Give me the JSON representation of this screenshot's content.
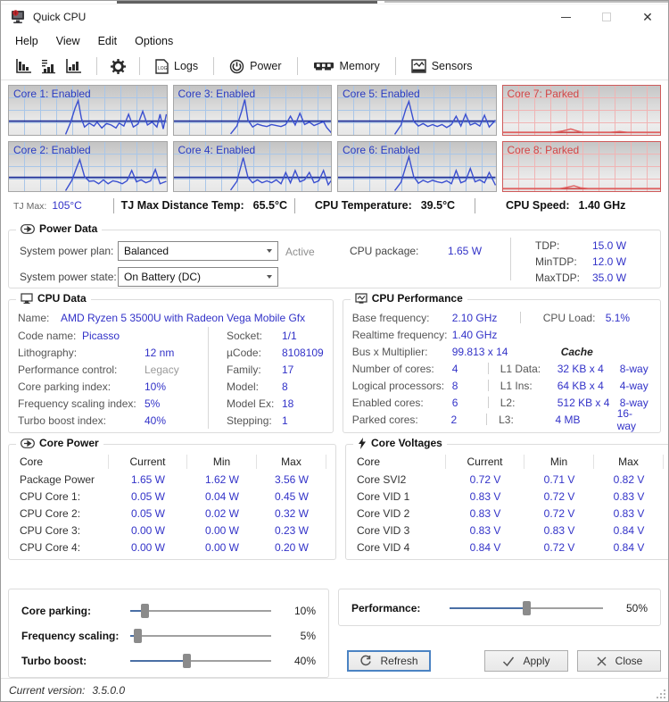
{
  "window": {
    "title": "Quick CPU"
  },
  "menu": {
    "items": [
      "Help",
      "View",
      "Edit",
      "Options"
    ]
  },
  "toolbar": {
    "logs": "Logs",
    "power": "Power",
    "memory": "Memory",
    "sensors": "Sensors"
  },
  "colors": {
    "value_blue": "#3232c8",
    "enabled_line": "#3a4fd0",
    "enabled_baseline": "#1d2f9a",
    "parked_line": "#e06060",
    "parked_baseline": "#cc4a4a"
  },
  "cores": [
    {
      "label": "Core 1: Enabled",
      "state": "enabled",
      "baseline": 72,
      "points": [
        [
          36,
          99
        ],
        [
          39,
          76
        ],
        [
          42,
          46
        ],
        [
          44,
          30
        ],
        [
          46,
          66
        ],
        [
          48,
          84
        ],
        [
          51,
          76
        ],
        [
          54,
          82
        ],
        [
          56,
          74
        ],
        [
          59,
          86
        ],
        [
          62,
          77
        ],
        [
          65,
          80
        ],
        [
          68,
          86
        ],
        [
          70,
          76
        ],
        [
          73,
          82
        ],
        [
          76,
          58
        ],
        [
          79,
          84
        ],
        [
          82,
          78
        ],
        [
          85,
          52
        ],
        [
          88,
          80
        ],
        [
          91,
          74
        ],
        [
          94,
          84
        ],
        [
          96,
          58
        ],
        [
          98,
          88
        ],
        [
          100,
          58
        ]
      ]
    },
    {
      "label": "Core 3: Enabled",
      "state": "enabled",
      "baseline": 72,
      "points": [
        [
          36,
          98
        ],
        [
          40,
          82
        ],
        [
          43,
          52
        ],
        [
          45,
          28
        ],
        [
          47,
          70
        ],
        [
          50,
          84
        ],
        [
          53,
          78
        ],
        [
          56,
          81
        ],
        [
          59,
          83
        ],
        [
          62,
          79
        ],
        [
          65,
          81
        ],
        [
          68,
          83
        ],
        [
          71,
          79
        ],
        [
          74,
          62
        ],
        [
          77,
          80
        ],
        [
          80,
          56
        ],
        [
          83,
          79
        ],
        [
          86,
          74
        ],
        [
          89,
          81
        ],
        [
          92,
          77
        ],
        [
          95,
          73
        ],
        [
          97,
          85
        ],
        [
          100,
          96
        ]
      ]
    },
    {
      "label": "Core 5: Enabled",
      "state": "enabled",
      "baseline": 72,
      "points": [
        [
          36,
          99
        ],
        [
          40,
          80
        ],
        [
          43,
          48
        ],
        [
          45,
          32
        ],
        [
          48,
          72
        ],
        [
          51,
          82
        ],
        [
          54,
          77
        ],
        [
          57,
          83
        ],
        [
          60,
          79
        ],
        [
          63,
          83
        ],
        [
          66,
          79
        ],
        [
          69,
          85
        ],
        [
          72,
          79
        ],
        [
          75,
          62
        ],
        [
          78,
          82
        ],
        [
          81,
          58
        ],
        [
          84,
          80
        ],
        [
          87,
          76
        ],
        [
          90,
          82
        ],
        [
          93,
          60
        ],
        [
          96,
          84
        ],
        [
          100,
          70
        ]
      ]
    },
    {
      "label": "Core 7: Parked",
      "state": "parked",
      "baseline": 95,
      "points": [
        [
          0,
          95
        ],
        [
          32,
          95
        ],
        [
          38,
          92
        ],
        [
          43,
          88
        ],
        [
          47,
          92
        ],
        [
          51,
          95
        ],
        [
          68,
          95
        ],
        [
          74,
          93
        ],
        [
          79,
          95
        ],
        [
          100,
          95
        ]
      ]
    },
    {
      "label": "Core 2: Enabled",
      "state": "enabled",
      "baseline": 72,
      "points": [
        [
          36,
          99
        ],
        [
          40,
          78
        ],
        [
          43,
          52
        ],
        [
          45,
          36
        ],
        [
          48,
          70
        ],
        [
          51,
          80
        ],
        [
          54,
          79
        ],
        [
          57,
          85
        ],
        [
          60,
          77
        ],
        [
          63,
          85
        ],
        [
          66,
          79
        ],
        [
          69,
          81
        ],
        [
          72,
          85
        ],
        [
          75,
          79
        ],
        [
          78,
          58
        ],
        [
          81,
          81
        ],
        [
          84,
          77
        ],
        [
          87,
          83
        ],
        [
          90,
          79
        ],
        [
          93,
          56
        ],
        [
          96,
          85
        ],
        [
          100,
          80
        ]
      ]
    },
    {
      "label": "Core 4: Enabled",
      "state": "enabled",
      "baseline": 72,
      "points": [
        [
          36,
          98
        ],
        [
          40,
          80
        ],
        [
          42,
          56
        ],
        [
          44,
          32
        ],
        [
          47,
          72
        ],
        [
          50,
          83
        ],
        [
          53,
          77
        ],
        [
          56,
          83
        ],
        [
          59,
          79
        ],
        [
          62,
          83
        ],
        [
          65,
          77
        ],
        [
          68,
          85
        ],
        [
          71,
          62
        ],
        [
          74,
          83
        ],
        [
          77,
          58
        ],
        [
          80,
          81
        ],
        [
          83,
          77
        ],
        [
          86,
          62
        ],
        [
          89,
          83
        ],
        [
          92,
          79
        ],
        [
          95,
          58
        ],
        [
          98,
          87
        ],
        [
          100,
          78
        ]
      ]
    },
    {
      "label": "Core 6: Enabled",
      "state": "enabled",
      "baseline": 72,
      "points": [
        [
          36,
          99
        ],
        [
          40,
          82
        ],
        [
          43,
          50
        ],
        [
          45,
          30
        ],
        [
          48,
          70
        ],
        [
          51,
          84
        ],
        [
          54,
          78
        ],
        [
          57,
          82
        ],
        [
          60,
          78
        ],
        [
          63,
          81
        ],
        [
          66,
          83
        ],
        [
          69,
          79
        ],
        [
          72,
          85
        ],
        [
          75,
          58
        ],
        [
          78,
          83
        ],
        [
          81,
          79
        ],
        [
          84,
          54
        ],
        [
          87,
          81
        ],
        [
          90,
          77
        ],
        [
          93,
          83
        ],
        [
          96,
          62
        ],
        [
          100,
          88
        ]
      ]
    },
    {
      "label": "Core 8: Parked",
      "state": "parked",
      "baseline": 95,
      "points": [
        [
          0,
          95
        ],
        [
          36,
          95
        ],
        [
          41,
          92
        ],
        [
          45,
          89
        ],
        [
          49,
          93
        ],
        [
          54,
          95
        ],
        [
          100,
          95
        ]
      ]
    }
  ],
  "status_row": {
    "tj_max_label": "TJ Max:",
    "tj_max_value": "105°C",
    "items": [
      {
        "label": "TJ Max Distance Temp:",
        "value": "65.5°C"
      },
      {
        "label": "CPU Temperature:",
        "value": "39.5°C"
      },
      {
        "label": "CPU Speed:",
        "value": "1.40 GHz"
      }
    ]
  },
  "power_data": {
    "title": "Power Data",
    "plan_label": "System power plan:",
    "plan_value": "Balanced",
    "plan_status": "Active",
    "state_label": "System power state:",
    "state_value": "On Battery (DC)",
    "package_label": "CPU package:",
    "package_value": "1.65 W",
    "tdp": [
      {
        "label": "TDP:",
        "value": "15.0 W"
      },
      {
        "label": "MinTDP:",
        "value": "12.0 W"
      },
      {
        "label": "MaxTDP:",
        "value": "35.0 W"
      }
    ]
  },
  "cpu_data": {
    "title": "CPU Data",
    "name_label": "Name:",
    "name_value": "AMD Ryzen 5 3500U with Radeon Vega Mobile Gfx",
    "left": [
      {
        "label": "Code name:",
        "value": "Picasso"
      },
      {
        "label": "Lithography:",
        "value": "12 nm"
      },
      {
        "label": "Performance control:",
        "value": "Legacy"
      },
      {
        "label": "Core parking index:",
        "value": "10%"
      },
      {
        "label": "Frequency scaling index:",
        "value": "5%"
      },
      {
        "label": "Turbo boost index:",
        "value": "40%"
      }
    ],
    "right": [
      {
        "label": "Socket:",
        "value": "1/1"
      },
      {
        "label": "µCode:",
        "value": "8108109"
      },
      {
        "label": "Family:",
        "value": "17"
      },
      {
        "label": "Model:",
        "value": "8"
      },
      {
        "label": "Model Ex:",
        "value": "18"
      },
      {
        "label": "Stepping:",
        "value": "1"
      }
    ]
  },
  "cpu_performance": {
    "title": "CPU Performance",
    "rows": [
      {
        "label": "Base frequency:",
        "value": "2.10 GHz"
      },
      {
        "label": "Realtime frequency:",
        "value": "1.40 GHz"
      },
      {
        "label": "Bus x Multiplier:",
        "value": "99.813 x 14"
      },
      {
        "label": "Number of cores:",
        "value": "4"
      },
      {
        "label": "Logical processors:",
        "value": "8"
      },
      {
        "label": "Enabled cores:",
        "value": "6"
      },
      {
        "label": "Parked cores:",
        "value": "2"
      }
    ],
    "cpu_load_label": "CPU Load:",
    "cpu_load_value": "5.1%",
    "cache_title": "Cache",
    "cache": [
      {
        "label": "L1 Data:",
        "value": "32 KB x 4",
        "way": "8-way"
      },
      {
        "label": "L1 Ins:",
        "value": "64 KB x 4",
        "way": "4-way"
      },
      {
        "label": "L2:",
        "value": "512 KB x 4",
        "way": "8-way"
      },
      {
        "label": "L3:",
        "value": "4 MB",
        "way": "16-way"
      }
    ]
  },
  "core_power": {
    "title": "Core Power",
    "headers": [
      "Core",
      "Current",
      "Min",
      "Max"
    ],
    "rows": [
      {
        "label": "Package Power",
        "current": "1.65 W",
        "min": "1.62 W",
        "max": "3.56 W"
      },
      {
        "label": "CPU Core 1:",
        "current": "0.05 W",
        "min": "0.04 W",
        "max": "0.45 W"
      },
      {
        "label": "CPU Core 2:",
        "current": "0.05 W",
        "min": "0.02 W",
        "max": "0.32 W"
      },
      {
        "label": "CPU Core 3:",
        "current": "0.00 W",
        "min": "0.00 W",
        "max": "0.23 W"
      },
      {
        "label": "CPU Core 4:",
        "current": "0.00 W",
        "min": "0.00 W",
        "max": "0.20 W"
      }
    ]
  },
  "core_voltages": {
    "title": "Core Voltages",
    "headers": [
      "Core",
      "Current",
      "Min",
      "Max"
    ],
    "rows": [
      {
        "label": "Core SVI2",
        "current": "0.72 V",
        "min": "0.71 V",
        "max": "0.82 V"
      },
      {
        "label": "Core VID 1",
        "current": "0.83 V",
        "min": "0.72 V",
        "max": "0.83 V"
      },
      {
        "label": "Core VID 2",
        "current": "0.83 V",
        "min": "0.72 V",
        "max": "0.83 V"
      },
      {
        "label": "Core VID 3",
        "current": "0.83 V",
        "min": "0.83 V",
        "max": "0.84 V"
      },
      {
        "label": "Core VID 4",
        "current": "0.84 V",
        "min": "0.72 V",
        "max": "0.84 V"
      }
    ]
  },
  "tuning": {
    "sliders": [
      {
        "label": "Core parking:",
        "value": "10%",
        "percent": 10
      },
      {
        "label": "Frequency scaling:",
        "value": "5%",
        "percent": 5
      },
      {
        "label": "Turbo boost:",
        "value": "40%",
        "percent": 40
      }
    ]
  },
  "performance_slider": {
    "label": "Performance:",
    "value": "50%",
    "percent": 50
  },
  "action_buttons": {
    "refresh": "Refresh",
    "apply": "Apply",
    "close": "Close"
  },
  "status_bar": {
    "label": "Current version:",
    "value": "3.5.0.0"
  }
}
